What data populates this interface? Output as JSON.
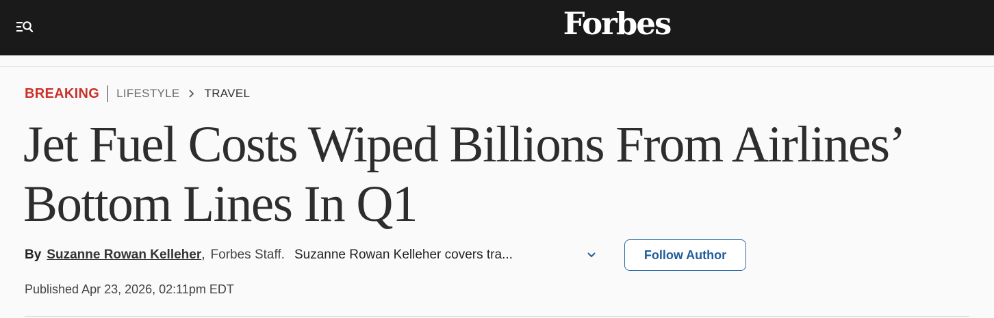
{
  "header": {
    "logo": "Forbes",
    "menu_icon": "menu-search-icon"
  },
  "breadcrumb": {
    "breaking": "BREAKING",
    "section": "LIFESTYLE",
    "subsection": "TRAVEL",
    "separator_icon": "chevron-right-icon"
  },
  "article": {
    "headline": "Jet Fuel Costs Wiped Billions From Airlines’ Bottom Lines In Q1",
    "by_label": "By",
    "author": "Suzanne Rowan Kelleher",
    "comma": ",",
    "staff": "Forbes Staff.",
    "bio": "Suzanne Rowan Kelleher covers tra...",
    "expand_icon": "chevron-down-icon",
    "follow_label": "Follow Author",
    "published": "Published Apr 23, 2026, 02:11pm EDT"
  },
  "colors": {
    "topbar": "#1a1a1a",
    "breaking": "#c8322a",
    "follow": "#1f5d9a",
    "background": "#fafafa"
  }
}
